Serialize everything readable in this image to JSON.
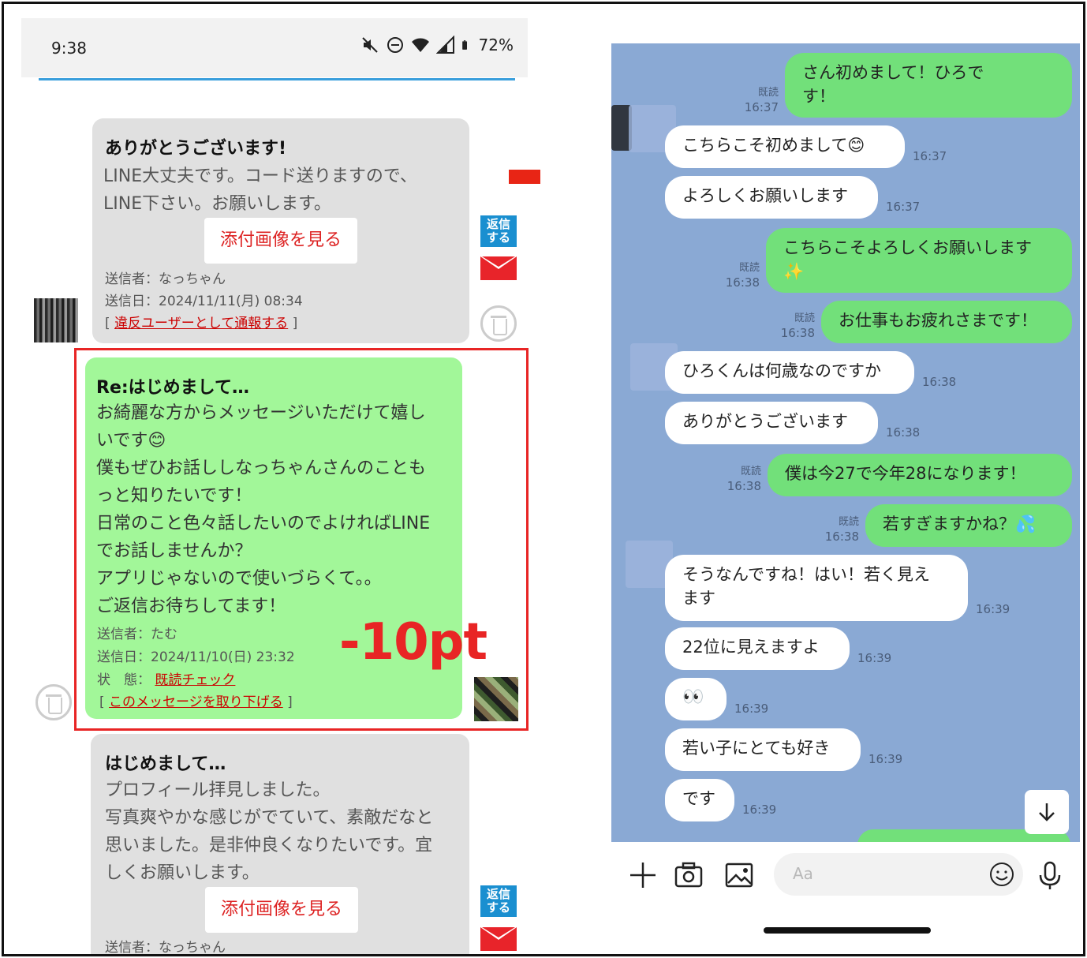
{
  "status": {
    "time": "9:38",
    "battery": "72%"
  },
  "left_messages": [
    {
      "title": "ありがとうございます!",
      "body": "LINE大丈夫です。コード送りますので、\nLINE下さい。お願いします。",
      "attach": "添付画像を見る",
      "sender": "送信者：なっちゃん",
      "date": "送信日：2024/11/11(月) 08:34",
      "report_open": "[",
      "report_link": "違反ユーザーとして通報する",
      "report_close": "]"
    },
    {
      "title": "Re:はじめまして…",
      "body": "お綺麗な方からメッセージいただけて嬉し\nいです😊\n僕もぜひお話ししなっちゃんさんのことも\nっと知りたいです！\n日常のこと色々話したいのでよければLINE\nでお話しませんか？\nアプリじゃないので使いづらくて。。\nご返信お待ちしてます！",
      "sender": "送信者：たむ",
      "date": "送信日：2024/11/10(日) 23:32",
      "status_label": "状　態：",
      "status_link": "既読チェック",
      "withdraw_open": "[",
      "withdraw_link": "このメッセージを取り下げる",
      "withdraw_close": "]"
    },
    {
      "title": "はじめまして…",
      "body": "プロフィール拝見しました。\n写真爽やかな感じがでていて、素敵だなと\n思いました。是非仲良くなりたいです。宜\nしくお願いします。",
      "attach": "添付画像を見る",
      "sender": "送信者：なっちゃん"
    }
  ],
  "reply_badge": "返信\nする",
  "annotation": "-10pt",
  "colors": {
    "highlight": "#e82525",
    "line_bg": "#8aa9d4",
    "me_bubble": "#72e07a"
  },
  "chat": [
    {
      "side": "me",
      "text": "さん初めまして！ひろで\nす！",
      "read": "既読",
      "time": "16:37"
    },
    {
      "side": "them",
      "text": "こちらこそ初めまして😊",
      "time": "16:37"
    },
    {
      "side": "them",
      "text": "よろしくお願いします",
      "time": "16:37"
    },
    {
      "side": "me",
      "text": "こちらこそよろしくお願いします\n✨",
      "read": "既読",
      "time": "16:38"
    },
    {
      "side": "me",
      "text": "お仕事もお疲れさまです！",
      "read": "既読",
      "time": "16:38"
    },
    {
      "side": "them",
      "text": "ひろくんは何歳なのですか",
      "time": "16:38"
    },
    {
      "side": "them",
      "text": "ありがとうございます",
      "time": "16:38"
    },
    {
      "side": "me",
      "text": "僕は今27で今年28になります！",
      "read": "既読",
      "time": "16:38"
    },
    {
      "side": "me",
      "text": "若すぎますかね？💦",
      "read": "既読",
      "time": "16:38"
    },
    {
      "side": "them",
      "text": "そうなんですね！はい！若く見え\nます",
      "time": "16:39"
    },
    {
      "side": "them",
      "text": "22位に見えますよ",
      "time": "16:39"
    },
    {
      "side": "them",
      "text": "👀",
      "time": "16:39"
    },
    {
      "side": "them",
      "text": "若い子にとても好き",
      "time": "16:39"
    },
    {
      "side": "them",
      "text": "です",
      "time": "16:39"
    }
  ],
  "input": {
    "placeholder": "Aa"
  },
  "icons": [
    "mute-icon",
    "dnd-icon",
    "wifi-icon",
    "signal-icon",
    "battery-icon",
    "plus-icon",
    "camera-icon",
    "image-icon",
    "emoji-icon",
    "mic-icon",
    "scroll-down-icon",
    "trash-icon",
    "envelope-icon"
  ]
}
